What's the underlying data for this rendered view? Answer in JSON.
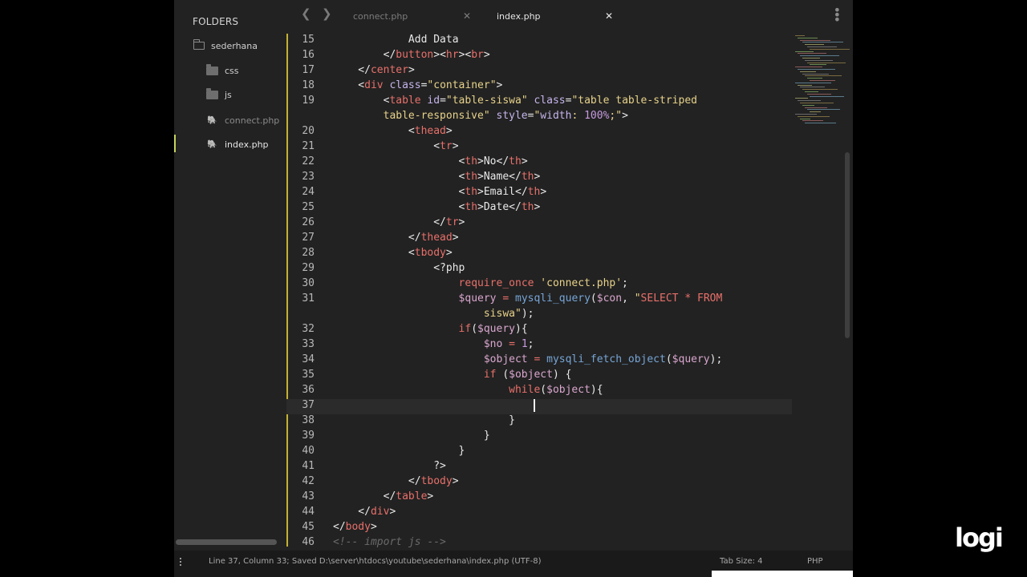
{
  "sidebar": {
    "title": "FOLDERS",
    "items": [
      {
        "label": "sederhana",
        "icon": "folder-open-icon"
      },
      {
        "label": "css",
        "icon": "folder-icon"
      },
      {
        "label": "js",
        "icon": "folder-icon"
      },
      {
        "label": "connect.php",
        "icon": "php-file-icon"
      },
      {
        "label": "index.php",
        "icon": "php-file-icon"
      }
    ]
  },
  "tabs": [
    {
      "label": "connect.php",
      "active": false
    },
    {
      "label": "index.php",
      "active": true
    }
  ],
  "editor": {
    "line_numbers": [
      "15",
      "16",
      "17",
      "18",
      "19",
      "20",
      "21",
      "22",
      "23",
      "24",
      "25",
      "26",
      "27",
      "28",
      "29",
      "30",
      "31",
      "32",
      "33",
      "34",
      "35",
      "36",
      "37",
      "38",
      "39",
      "40",
      "41",
      "42",
      "43",
      "44",
      "45",
      "46"
    ]
  },
  "statusbar": {
    "position": "Line 37, Column 33; Saved D:\\server\\htdocs\\youtube\\sederhana\\index.php (UTF-8)",
    "tab_size": "Tab Size: 4",
    "syntax": "PHP"
  },
  "overlay": {
    "logo": "logi"
  },
  "colors": {
    "gutter_marker": "#c5b134",
    "tab_underline": "#45868a",
    "tag": "#e8706a",
    "string": "#e7d28a",
    "function": "#76a5d6"
  }
}
